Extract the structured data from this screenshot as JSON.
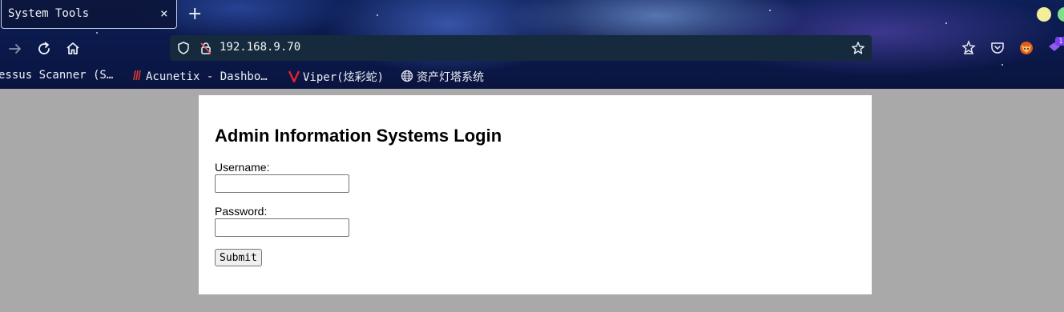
{
  "tab": {
    "title": "System Tools",
    "close_glyph": "×"
  },
  "new_tab_glyph": "+",
  "window_controls": {
    "minimize_color": "#f2ef9a",
    "maximize_color": "#7ee08d"
  },
  "navigation": {
    "forward_icon": "arrow-right-icon",
    "reload_icon": "reload-icon",
    "home_icon": "home-icon"
  },
  "address_bar": {
    "url": "192.168.9.70",
    "shield_icon": "shield-icon",
    "lock_icon": "insecure-lock-icon",
    "bookmark_icon": "star-icon"
  },
  "toolbar_icons": [
    "pocket-save-icon",
    "pocket-icon",
    "foxyproxy-icon",
    "extension-icon"
  ],
  "extension_badge": "1",
  "bookmarks": [
    {
      "label": "essus Scanner (S…",
      "icon": "none"
    },
    {
      "label": "Acunetix - Dashbo…",
      "icon": "acunetix-icon"
    },
    {
      "label": "Viper(炫彩蛇)",
      "icon": "viper-icon"
    },
    {
      "label": "资产灯塔系统",
      "icon": "globe-icon"
    }
  ],
  "page": {
    "heading": "Admin Information Systems Login",
    "username_label": "Username:",
    "password_label": "Password:",
    "username_value": "",
    "password_value": "",
    "submit_label": "Submit"
  },
  "colors": {
    "page_background": "#a9a9a9",
    "content_background": "#ffffff",
    "url_bar_background": "#152a3c",
    "chrome_background": "#0d1f57"
  }
}
